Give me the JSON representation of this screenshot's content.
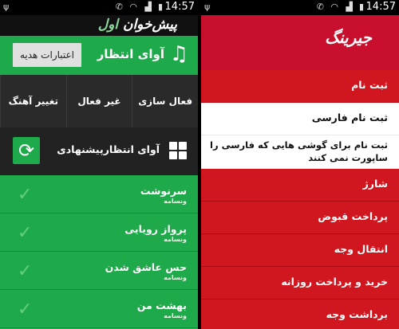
{
  "status_time": "14:57",
  "left_screen": {
    "brand_main": "پیش‌خوان",
    "brand_sub": "اول",
    "gift_button": "اعتبارات هدیه",
    "title": "آوای انتظار",
    "actions": [
      "فعال سازی",
      "غیر فعال سازی",
      "تغییر آهنگ"
    ],
    "suggested_title": "آوای انتظارپیشنهادی",
    "songs": [
      {
        "title": "سرنوشت",
        "subtitle": "ونسامه"
      },
      {
        "title": "پرواز رویایی",
        "subtitle": "ونسامه"
      },
      {
        "title": "حس عاشق شدن",
        "subtitle": "ونسامه"
      },
      {
        "title": "بهشت من",
        "subtitle": "ونسامه"
      }
    ]
  },
  "right_screen": {
    "brand": "جیرینگ",
    "items": [
      {
        "label": "ثبت نام",
        "style": "red"
      },
      {
        "label": "ثبت نام فارسی",
        "style": "white"
      },
      {
        "label": "ثبت نام برای گوشی هایی که فارسی را ساپورت نمی کنند",
        "style": "white"
      },
      {
        "label": "شارژ",
        "style": "red"
      },
      {
        "label": "پرداخت قبوض",
        "style": "red"
      },
      {
        "label": "انتقال وجه",
        "style": "red"
      },
      {
        "label": "خرید و پرداخت روزانه",
        "style": "red"
      },
      {
        "label": "برداشت وجه",
        "style": "red"
      }
    ]
  }
}
